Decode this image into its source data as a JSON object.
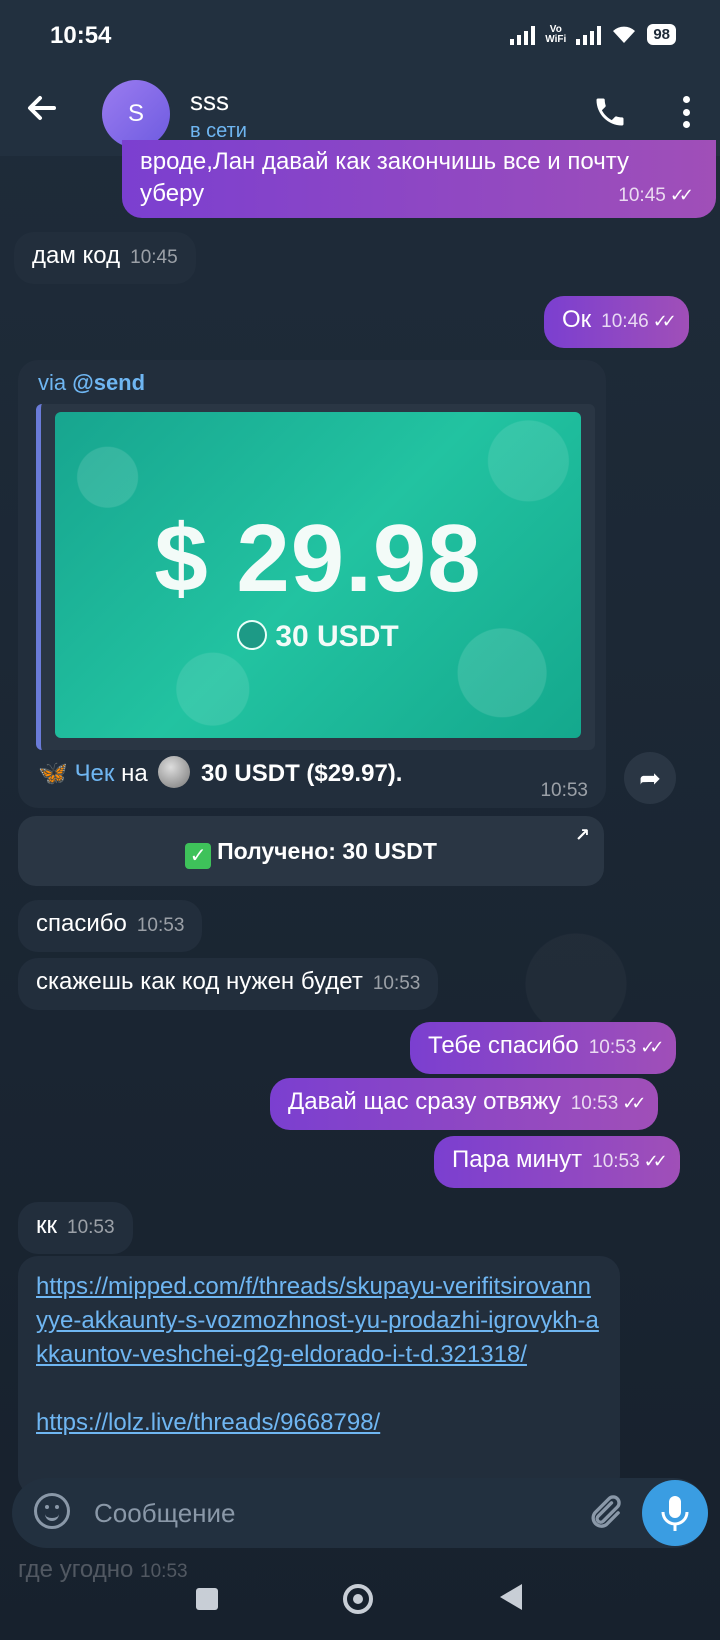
{
  "status_bar": {
    "time": "10:54",
    "vo_wifi": "Vo\nWiFi",
    "battery": "98"
  },
  "header": {
    "name": "sss",
    "avatar_letter": "S",
    "status": "в сети"
  },
  "messages": [
    {
      "text": "вроде,Лан давай как закончишь все и почту уберу",
      "time": "10:45"
    },
    {
      "text": "дам код",
      "time": "10:45"
    },
    {
      "text": "Ок",
      "time": "10:46"
    },
    {
      "text": "спасибо",
      "time": "10:53"
    },
    {
      "text": "скажешь как код нужен будет",
      "time": "10:53"
    },
    {
      "text": "Тебе спасибо",
      "time": "10:53"
    },
    {
      "text": "Давай щас сразу отвяжу",
      "time": "10:53"
    },
    {
      "text": "Пара минут",
      "time": "10:53"
    },
    {
      "text": "кк",
      "time": "10:53"
    }
  ],
  "check_card": {
    "via_prefix": "via",
    "via_bot": "@send",
    "amount": "$ 29.98",
    "amount_sub": "30 USDT",
    "butterfly": "🦋",
    "link_word": "Чек",
    "text_mid": "на",
    "text_amount": "30 USDT ($29.97).",
    "time": "10:53"
  },
  "received_button": {
    "label": "Получено: 30 USDT",
    "check": "✓",
    "ext": "↗"
  },
  "links": [
    "https://mipped.com/f/threads/skupayu-verifitsirovannyye-akkaunty-s-vozmozhnost-yu-prodazhi-igrovykh-akkauntov-veshchei-g2g-eldorado-i-t-d.321318/",
    "https://lolz.live/threads/9668798/"
  ],
  "composer": {
    "placeholder": "Сообщение"
  },
  "faded_message": {
    "text": "где угодно",
    "time": "10:53"
  },
  "colors": {
    "accent": "#6fb6f2",
    "outgoing": "#8a45c8",
    "incoming": "#222e3c",
    "check_bg": "#1fb396"
  }
}
